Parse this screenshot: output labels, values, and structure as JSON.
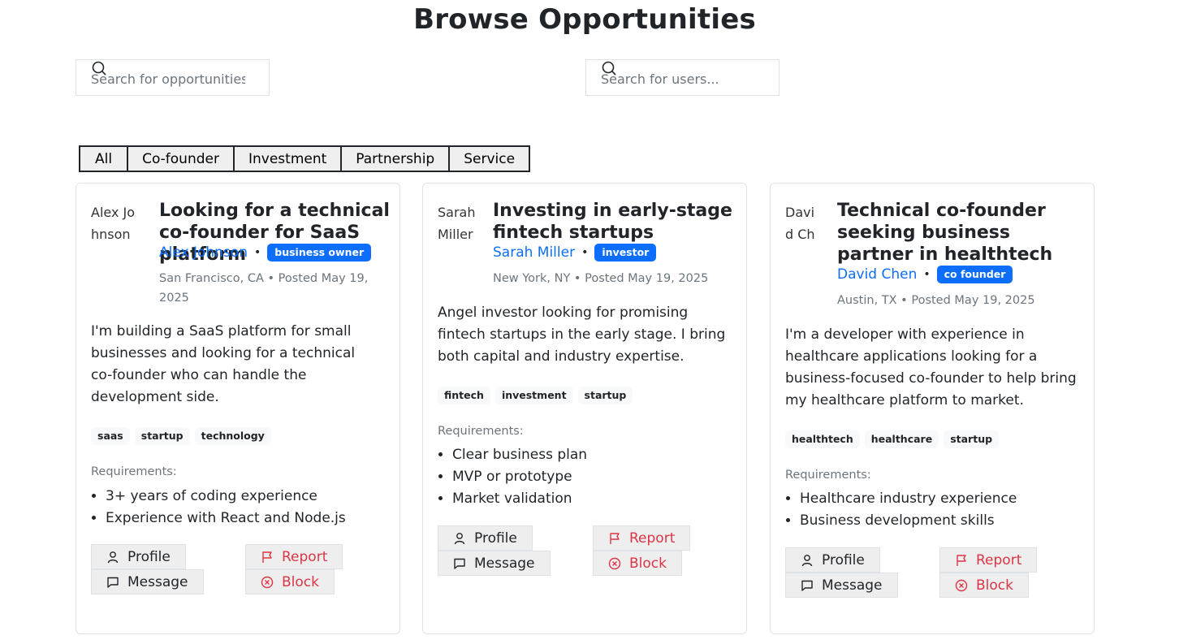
{
  "page": {
    "title": "Browse Opportunities"
  },
  "search": {
    "opportunities_placeholder": "Search for opportunities...",
    "users_placeholder": "Search for users..."
  },
  "filters": [
    "All",
    "Co-founder",
    "Investment",
    "Partnership",
    "Service"
  ],
  "colors": {
    "link": "#0d6efd",
    "badge": "#0d6efd",
    "danger": "#dc3545",
    "muted": "#6c757d"
  },
  "actions": {
    "profile": "Profile",
    "message": "Message",
    "report": "Report",
    "block": "Block"
  },
  "cards": [
    {
      "avatar_alt": "Alex Johnson",
      "title": "Looking for a technical co-founder for SaaS platform",
      "author": "Alex Johnson",
      "role": "business owner",
      "location_posted": "San Francisco, CA • Posted May 19, 2025",
      "description": "I'm building a SaaS platform for small businesses and looking for a technical co-founder who can handle the development side.",
      "tags": [
        "saas",
        "startup",
        "technology"
      ],
      "requirements_label": "Requirements:",
      "requirements": [
        "3+ years of coding experience",
        "Experience with React and Node.js"
      ]
    },
    {
      "avatar_alt": "Sarah Miller",
      "title": "Investing in early-stage fintech startups",
      "author": "Sarah Miller",
      "role": "investor",
      "location_posted": "New York, NY • Posted May 19, 2025",
      "description": "Angel investor looking for promising fintech startups in the early stage. I bring both capital and industry expertise.",
      "tags": [
        "fintech",
        "investment",
        "startup"
      ],
      "requirements_label": "Requirements:",
      "requirements": [
        "Clear business plan",
        "MVP or prototype",
        "Market validation"
      ]
    },
    {
      "avatar_alt": "David Chen",
      "title": "Technical co-founder seeking business partner in healthtech",
      "author": "David Chen",
      "role": "co founder",
      "location_posted": "Austin, TX • Posted May 19, 2025",
      "description": "I'm a developer with experience in healthcare applications looking for a business-focused co-founder to help bring my healthcare platform to market.",
      "tags": [
        "healthtech",
        "healthcare",
        "startup"
      ],
      "requirements_label": "Requirements:",
      "requirements": [
        "Healthcare industry experience",
        "Business development skills"
      ]
    }
  ]
}
